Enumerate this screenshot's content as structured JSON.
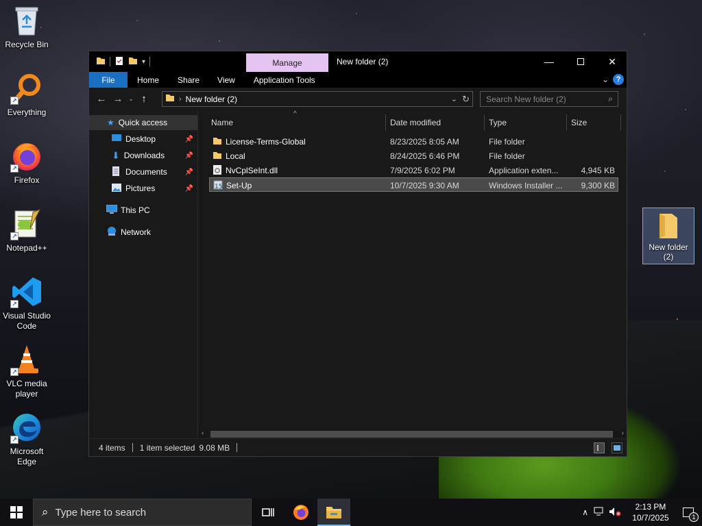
{
  "desktop": {
    "icons": [
      {
        "label": "Recycle Bin"
      },
      {
        "label": "Everything"
      },
      {
        "label": "Firefox"
      },
      {
        "label": "Notepad++"
      },
      {
        "label": "Visual Studio Code"
      },
      {
        "label": "VLC media player"
      },
      {
        "label": "Microsoft Edge"
      }
    ],
    "folder_label": "New folder (2)"
  },
  "window": {
    "title": "New folder (2)",
    "context_tab": "Manage",
    "ribbon_tabs": [
      "File",
      "Home",
      "Share",
      "View",
      "Application Tools"
    ],
    "help_glyph": "?",
    "address": {
      "crumb": "New folder (2)"
    },
    "search_placeholder": "Search New folder (2)",
    "nav": {
      "quick_access": "Quick access",
      "desktop": "Desktop",
      "downloads": "Downloads",
      "documents": "Documents",
      "pictures": "Pictures",
      "this_pc": "This PC",
      "network": "Network"
    },
    "columns": {
      "name": "Name",
      "date": "Date modified",
      "type": "Type",
      "size": "Size"
    },
    "files": [
      {
        "name": "License-Terms-Global",
        "date": "8/23/2025 8:05 AM",
        "type": "File folder",
        "size": "",
        "icon": "folder-icon"
      },
      {
        "name": "Local",
        "date": "8/24/2025 6:46 PM",
        "type": "File folder",
        "size": "",
        "icon": "folder-icon"
      },
      {
        "name": "NvCplSeInt.dll",
        "date": "7/9/2025 6:02 PM",
        "type": "Application exten...",
        "size": "4,945 KB",
        "icon": "dll-file-icon"
      },
      {
        "name": "Set-Up",
        "date": "10/7/2025 9:30 AM",
        "type": "Windows Installer ...",
        "size": "9,300 KB",
        "icon": "installer-icon",
        "selected": true
      }
    ],
    "status": {
      "items": "4 items",
      "selection": "1 item selected",
      "size": "9.08 MB"
    }
  },
  "taskbar": {
    "search_placeholder": "Type here to search",
    "time": "2:13 PM",
    "date": "10/7/2025",
    "notification_count": "1"
  },
  "colors": {
    "accent": "#1a6fc2",
    "manage_tab": "#e5c4f2",
    "folder": "#f3c969"
  }
}
